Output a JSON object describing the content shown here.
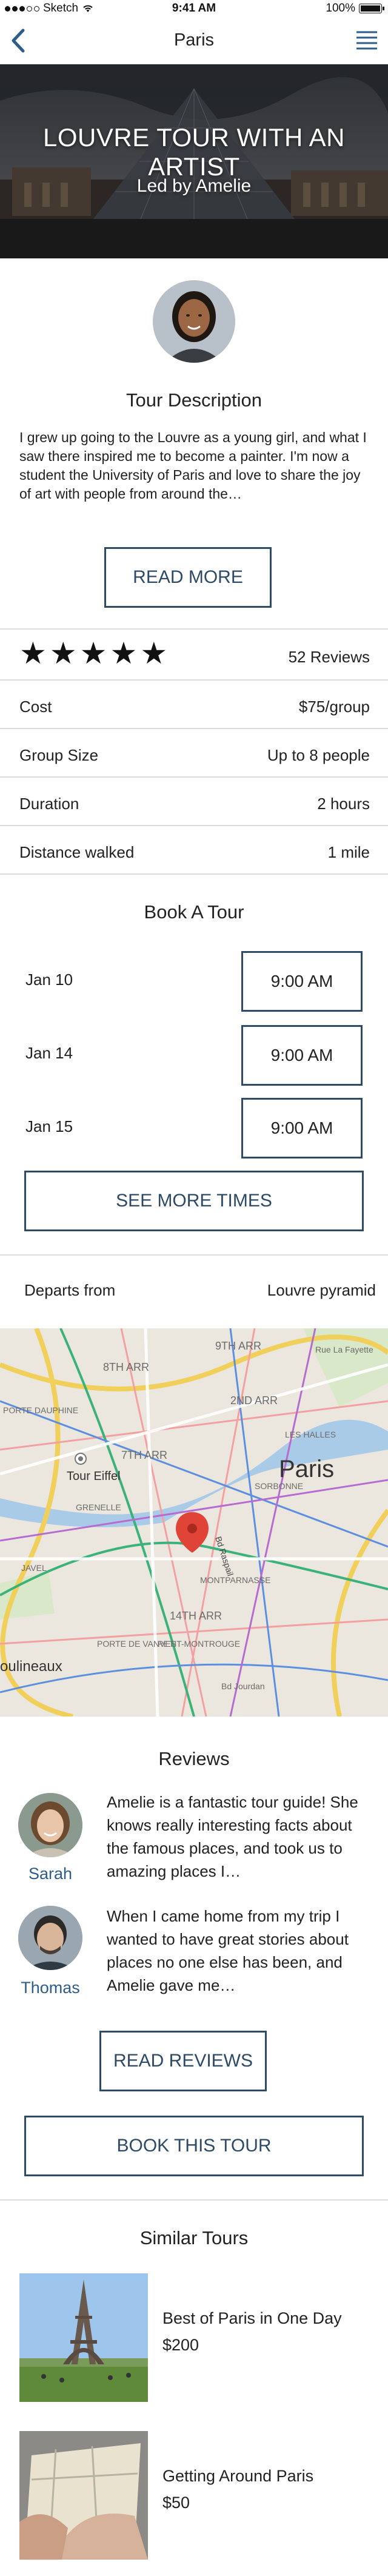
{
  "status_bar": {
    "carrier": "Sketch",
    "time": "9:41 AM",
    "battery": "100%"
  },
  "nav": {
    "title": "Paris",
    "back_icon": "back-chevron-icon",
    "menu_icon": "hamburger-menu-icon"
  },
  "hero": {
    "title": "LOUVRE TOUR WITH AN ARTIST",
    "subtitle": "Led by Amelie"
  },
  "description": {
    "heading": "Tour Description",
    "text": "I grew up going to the Louvre as a young girl, and what I saw there inspired me to become a painter. I'm now a student the University of Paris and love to share the joy of art with people from around the…",
    "read_more": "READ MORE"
  },
  "details": {
    "rating": 5,
    "reviews_count": "52 Reviews",
    "rows": [
      {
        "label": "Cost",
        "value": "$75/group"
      },
      {
        "label": "Group Size",
        "value": "Up to 8 people"
      },
      {
        "label": "Duration",
        "value": "2 hours"
      },
      {
        "label": "Distance walked",
        "value": "1 mile"
      }
    ]
  },
  "booking": {
    "heading": "Book A Tour",
    "slots": [
      {
        "date": "Jan 10",
        "time": "9:00 AM"
      },
      {
        "date": "Jan 14",
        "time": "9:00 AM"
      },
      {
        "date": "Jan 15",
        "time": "9:00 AM"
      }
    ],
    "more_times": "SEE MORE TIMES"
  },
  "departure": {
    "label": "Departs from",
    "value": "Louvre pyramid"
  },
  "map": {
    "labels": [
      "9TH ARR",
      "8TH ARR",
      "2ND ARR",
      "PORTE DAUPHINE",
      "7TH ARR",
      "LES HALLES",
      "Paris",
      "Tour Eiffel",
      "SORBONNE",
      "GRENELLE",
      "Bd Raspail",
      "JAVEL",
      "MONTPARNASSE",
      "14TH ARR",
      "PORTE DE VANVES",
      "PETIT-MONTROUGE",
      "oulineaux",
      "Bd Jourdan",
      "Rue La Fayette"
    ]
  },
  "reviews": {
    "heading": "Reviews",
    "items": [
      {
        "name": "Sarah",
        "text": "Amelie is a fantastic tour guide! She knows really interesting facts about the famous places, and took us to amazing places I…"
      },
      {
        "name": "Thomas",
        "text": "When I came home from my trip I wanted to have great stories about places no one else has been, and Amelie gave me…"
      }
    ],
    "read_reviews": "READ REVIEWS"
  },
  "book_button": "BOOK THIS TOUR",
  "similar": {
    "heading": "Similar Tours",
    "items": [
      {
        "title": "Best of Paris in One Day",
        "price": "$200"
      },
      {
        "title": "Getting Around Paris",
        "price": "$50"
      }
    ]
  },
  "colors": {
    "accent": "#2d4a66",
    "link": "#2d5d8a",
    "divider": "#dcdcdc"
  }
}
